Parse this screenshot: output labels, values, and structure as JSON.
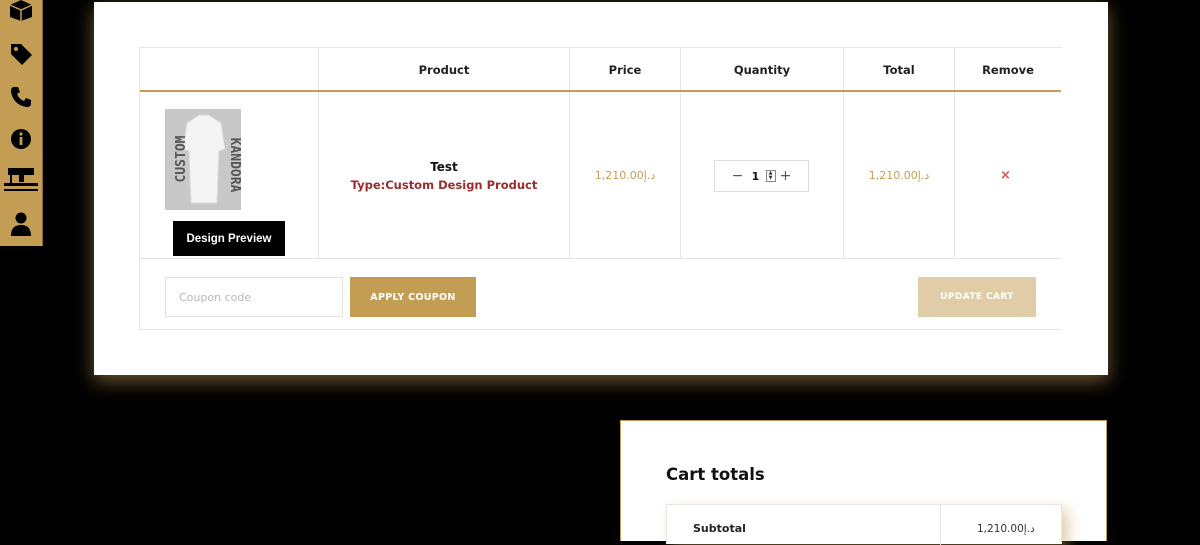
{
  "sidebar": {
    "icons": [
      "box-icon",
      "tag-icon",
      "phone-icon",
      "info-icon",
      "sewing-machine-icon",
      "user-icon"
    ]
  },
  "cart": {
    "headers": {
      "product": "Product",
      "price": "Price",
      "quantity": "Quantity",
      "total": "Total",
      "remove": "Remove"
    },
    "items": [
      {
        "thumb_text_1": "CUSTOM",
        "thumb_text_2": "KANDORA",
        "preview_label": "Design Preview",
        "name": "Test",
        "type": "Type:Custom Design Product",
        "price": "د.إ1,210.00",
        "quantity": "1",
        "total": "د.إ1,210.00",
        "remove_symbol": "×"
      }
    ],
    "coupon_placeholder": "Coupon code",
    "apply_label": "APPLY COUPON",
    "update_label": "UPDATE CART"
  },
  "totals": {
    "title": "Cart totals",
    "subtotal_label": "Subtotal",
    "subtotal_value": "د.إ1,210.00"
  },
  "colors": {
    "accent": "#c49d55",
    "accent_light": "#e0cca6",
    "type_text": "#9b2c2c",
    "remove": "#d9534f"
  }
}
